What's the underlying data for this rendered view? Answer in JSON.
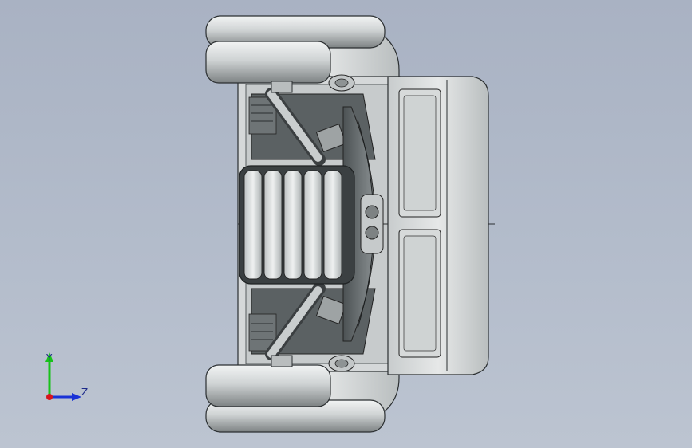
{
  "viewport": {
    "background_top": "#a9b2c3",
    "background_bottom": "#bcc4d1"
  },
  "triad": {
    "y_label": "Y",
    "z_label": "Z",
    "x_color": "#d8141c",
    "y_color": "#18c21a",
    "z_color": "#1a32d6"
  },
  "model": {
    "name_icon": "wheeled-robot-chassis-icon",
    "body_color": "#d9dcdc",
    "edge_color": "#2b2f31",
    "shadow_color": "#8b9092"
  }
}
